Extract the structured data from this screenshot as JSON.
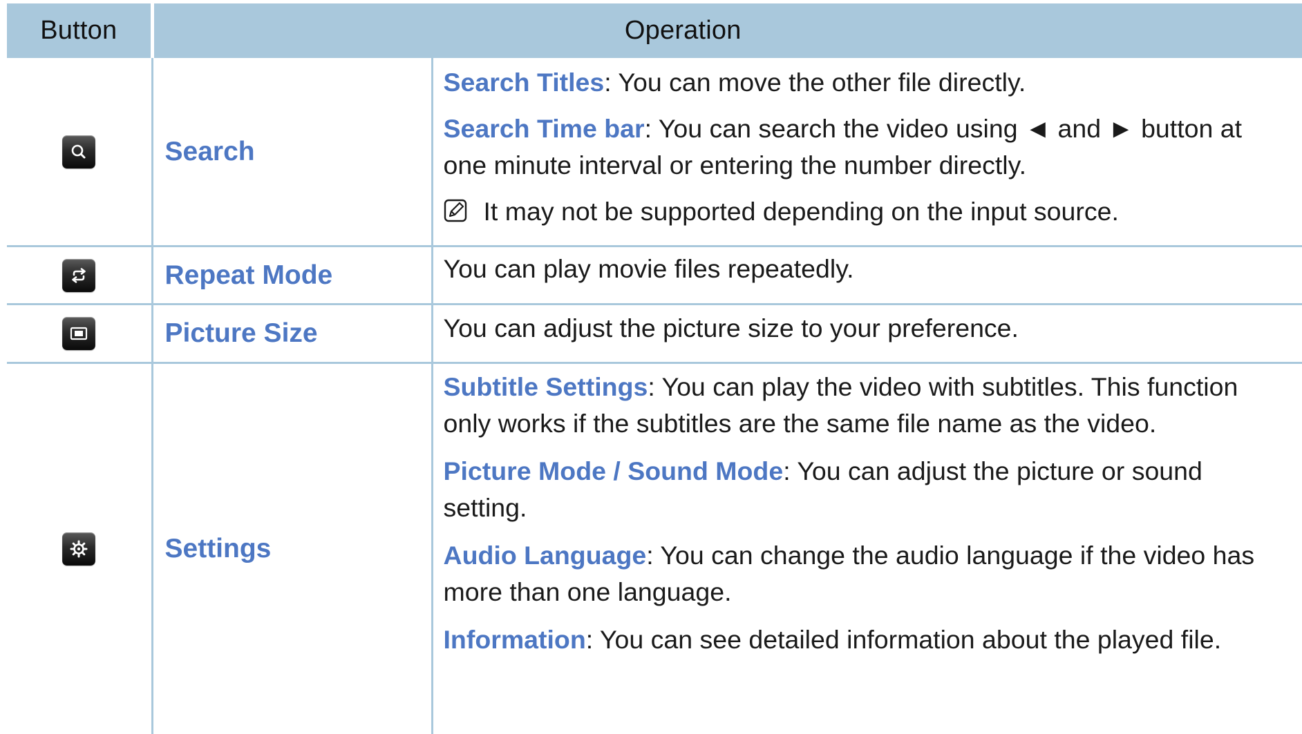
{
  "table": {
    "headers": {
      "button": "Button",
      "operation": "Operation"
    },
    "rows": [
      {
        "icon": "search-icon",
        "name": "Search",
        "items": [
          {
            "term": "Search Titles",
            "text": ": You can move the other file directly."
          },
          {
            "term": "Search Time bar",
            "text": ": You can search the video using ◄ and ► button at one minute interval or entering the number directly."
          }
        ],
        "note": "It may not be supported depending on the input source."
      },
      {
        "icon": "repeat-icon",
        "name": "Repeat Mode",
        "description": "You can play movie files repeatedly."
      },
      {
        "icon": "picture-size-icon",
        "name": "Picture Size",
        "description": "You can adjust the picture size to your preference."
      },
      {
        "icon": "settings-gear-icon",
        "name": "Settings",
        "items": [
          {
            "term": "Subtitle Settings",
            "text": ": You can play the video with subtitles. This function only works if the subtitles are the same file name as the video."
          },
          {
            "term": "Picture Mode / Sound Mode",
            "text": ": You can adjust the picture or sound setting."
          },
          {
            "term": "Audio Language",
            "text": ": You can change the audio language if the video has more than one language."
          },
          {
            "term": "Information",
            "text": ": You can see detailed information about the played file."
          }
        ]
      }
    ]
  },
  "colors": {
    "header_bg": "#a9c8dc",
    "term_blue": "#4d77c3",
    "text": "#1a1a1a"
  }
}
